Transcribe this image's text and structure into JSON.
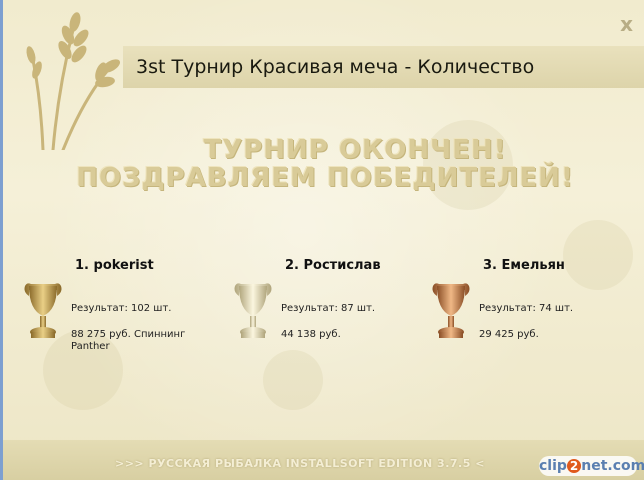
{
  "window": {
    "title": "3st Турнир Красивая меча - Количество",
    "close_label": "x"
  },
  "headline": {
    "line1": "ТУРНИР ОКОНЧЕН!",
    "line2": "ПОЗДРАВЛЯЕМ ПОБЕДИТЕЛЕЙ!"
  },
  "winners": [
    {
      "name": "1. pokerist",
      "result": "Результат: 102 шт.",
      "prize": "88 275 руб. Спиннинг Panther",
      "cup": "gold-cup-icon"
    },
    {
      "name": "2. Ростислав",
      "result": "Результат: 87 шт.",
      "prize": "44 138 руб.",
      "cup": "silver-cup-icon"
    },
    {
      "name": "3. Емельян",
      "result": "Результат: 74 шт.",
      "prize": "29 425 руб.",
      "cup": "bronze-cup-icon"
    }
  ],
  "footer": {
    "text": ">>> РУССКАЯ РЫБАЛКА INSTALLSOFT EDITION 3.7.5 <"
  },
  "watermark": {
    "text_a": "clip",
    "text_b": "2",
    "text_c": "net.com"
  },
  "colors": {
    "gold": "#c9a44c",
    "silver": "#d8d2b4",
    "bronze": "#c0804a"
  }
}
